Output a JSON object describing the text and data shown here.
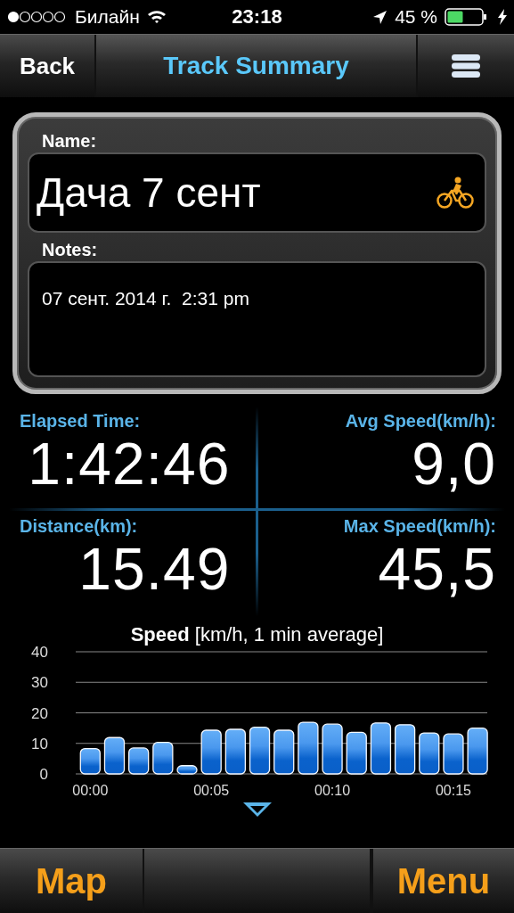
{
  "status_bar": {
    "carrier": "Билайн",
    "time": "23:18",
    "battery": "45 %"
  },
  "nav": {
    "back": "Back",
    "title": "Track Summary"
  },
  "track": {
    "name_label": "Name:",
    "name": "Дача 7 сент",
    "notes_label": "Notes:",
    "notes": "07 сент. 2014 г.  2:31 pm"
  },
  "stats": [
    {
      "label": "Elapsed Time:",
      "value": "1:42:46"
    },
    {
      "label": "Avg Speed(km/h):",
      "value": "9,0"
    },
    {
      "label": "Distance(km):",
      "value": "15.49"
    },
    {
      "label": "Max Speed(km/h):",
      "value": "45,5"
    }
  ],
  "chart": {
    "title": "**Speed** [km/h, 1 min average]",
    "chart_data": {
      "type": "bar",
      "x": [
        0,
        1,
        2,
        3,
        4,
        5,
        6,
        7,
        8,
        9,
        10,
        11,
        12,
        13,
        14,
        15,
        16
      ],
      "values": [
        8.3,
        11.9,
        8.5,
        10.3,
        2.7,
        14.3,
        14.6,
        15.3,
        14.3,
        16.9,
        16.3,
        13.6,
        16.7,
        16.1,
        13.4,
        13.1,
        15
      ],
      "xlim": [
        -0.6,
        16.4
      ],
      "ylim": [
        0,
        40
      ],
      "grid": true,
      "yticks": [
        0,
        10,
        20,
        30,
        40
      ],
      "xticks": [
        {
          "value": 0,
          "label": "00:00"
        },
        {
          "value": 5,
          "label": "00:05"
        },
        {
          "value": 10,
          "label": "00:10"
        },
        {
          "value": 15,
          "label": "00:15"
        }
      ]
    }
  },
  "bottom_bar": {
    "left": "Map",
    "right": "Menu"
  }
}
